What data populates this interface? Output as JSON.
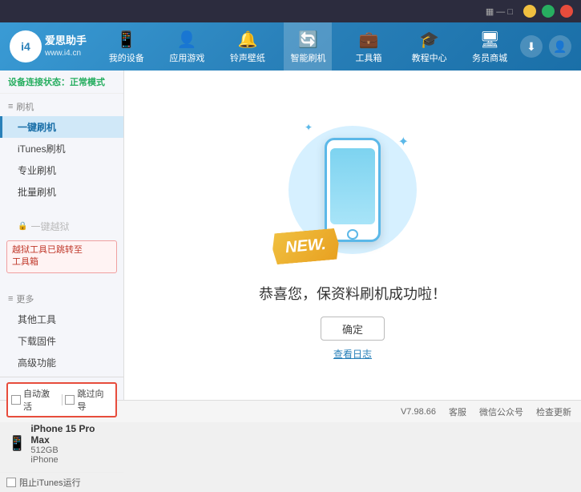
{
  "app": {
    "title": "爱思助手",
    "subtitle": "www.i4.cn"
  },
  "topbar": {
    "controls": [
      "minimize",
      "maximize",
      "close"
    ]
  },
  "nav": {
    "items": [
      {
        "id": "my-device",
        "icon": "📱",
        "label": "我的设备"
      },
      {
        "id": "apps-games",
        "icon": "👤",
        "label": "应用游戏"
      },
      {
        "id": "ringtones",
        "icon": "🔔",
        "label": "铃声壁纸"
      },
      {
        "id": "smart-flash",
        "icon": "🔄",
        "label": "智能刷机",
        "active": true
      },
      {
        "id": "toolbox",
        "icon": "💼",
        "label": "工具箱"
      },
      {
        "id": "tutorial",
        "icon": "🎓",
        "label": "教程中心"
      },
      {
        "id": "service",
        "icon": "🖥",
        "label": "务员商城"
      }
    ],
    "download_icon": "⬇",
    "user_icon": "👤"
  },
  "sidebar": {
    "status_label": "设备连接状态：",
    "status_value": "正常模式",
    "flash_section": "刷机",
    "items": [
      {
        "id": "one-click-flash",
        "label": "一键刷机",
        "active": true
      },
      {
        "id": "itunes-flash",
        "label": "iTunes刷机",
        "active": false
      },
      {
        "id": "pro-flash",
        "label": "专业刷机",
        "active": false
      },
      {
        "id": "batch-flash",
        "label": "批量刷机",
        "active": false
      }
    ],
    "disabled_item": "一键越狱",
    "warning_text": "越狱工具已跳转至\n工具箱",
    "more_section": "更多",
    "more_items": [
      {
        "id": "other-tools",
        "label": "其他工具"
      },
      {
        "id": "download-firmware",
        "label": "下载固件"
      },
      {
        "id": "advanced",
        "label": "高级功能"
      }
    ],
    "auto_activate": "自动激活",
    "skip_guide": "跳过向导",
    "device_name": "iPhone 15 Pro Max",
    "device_storage": "512GB",
    "device_type": "iPhone",
    "itunes_label": "阻止iTunes运行"
  },
  "content": {
    "new_badge": "NEW.",
    "success_text": "恭喜您，保资料刷机成功啦！",
    "ok_button": "确定",
    "log_link": "查看日志"
  },
  "footer": {
    "version": "V7.98.66",
    "links": [
      "客服",
      "微信公众号",
      "检查更新"
    ]
  }
}
